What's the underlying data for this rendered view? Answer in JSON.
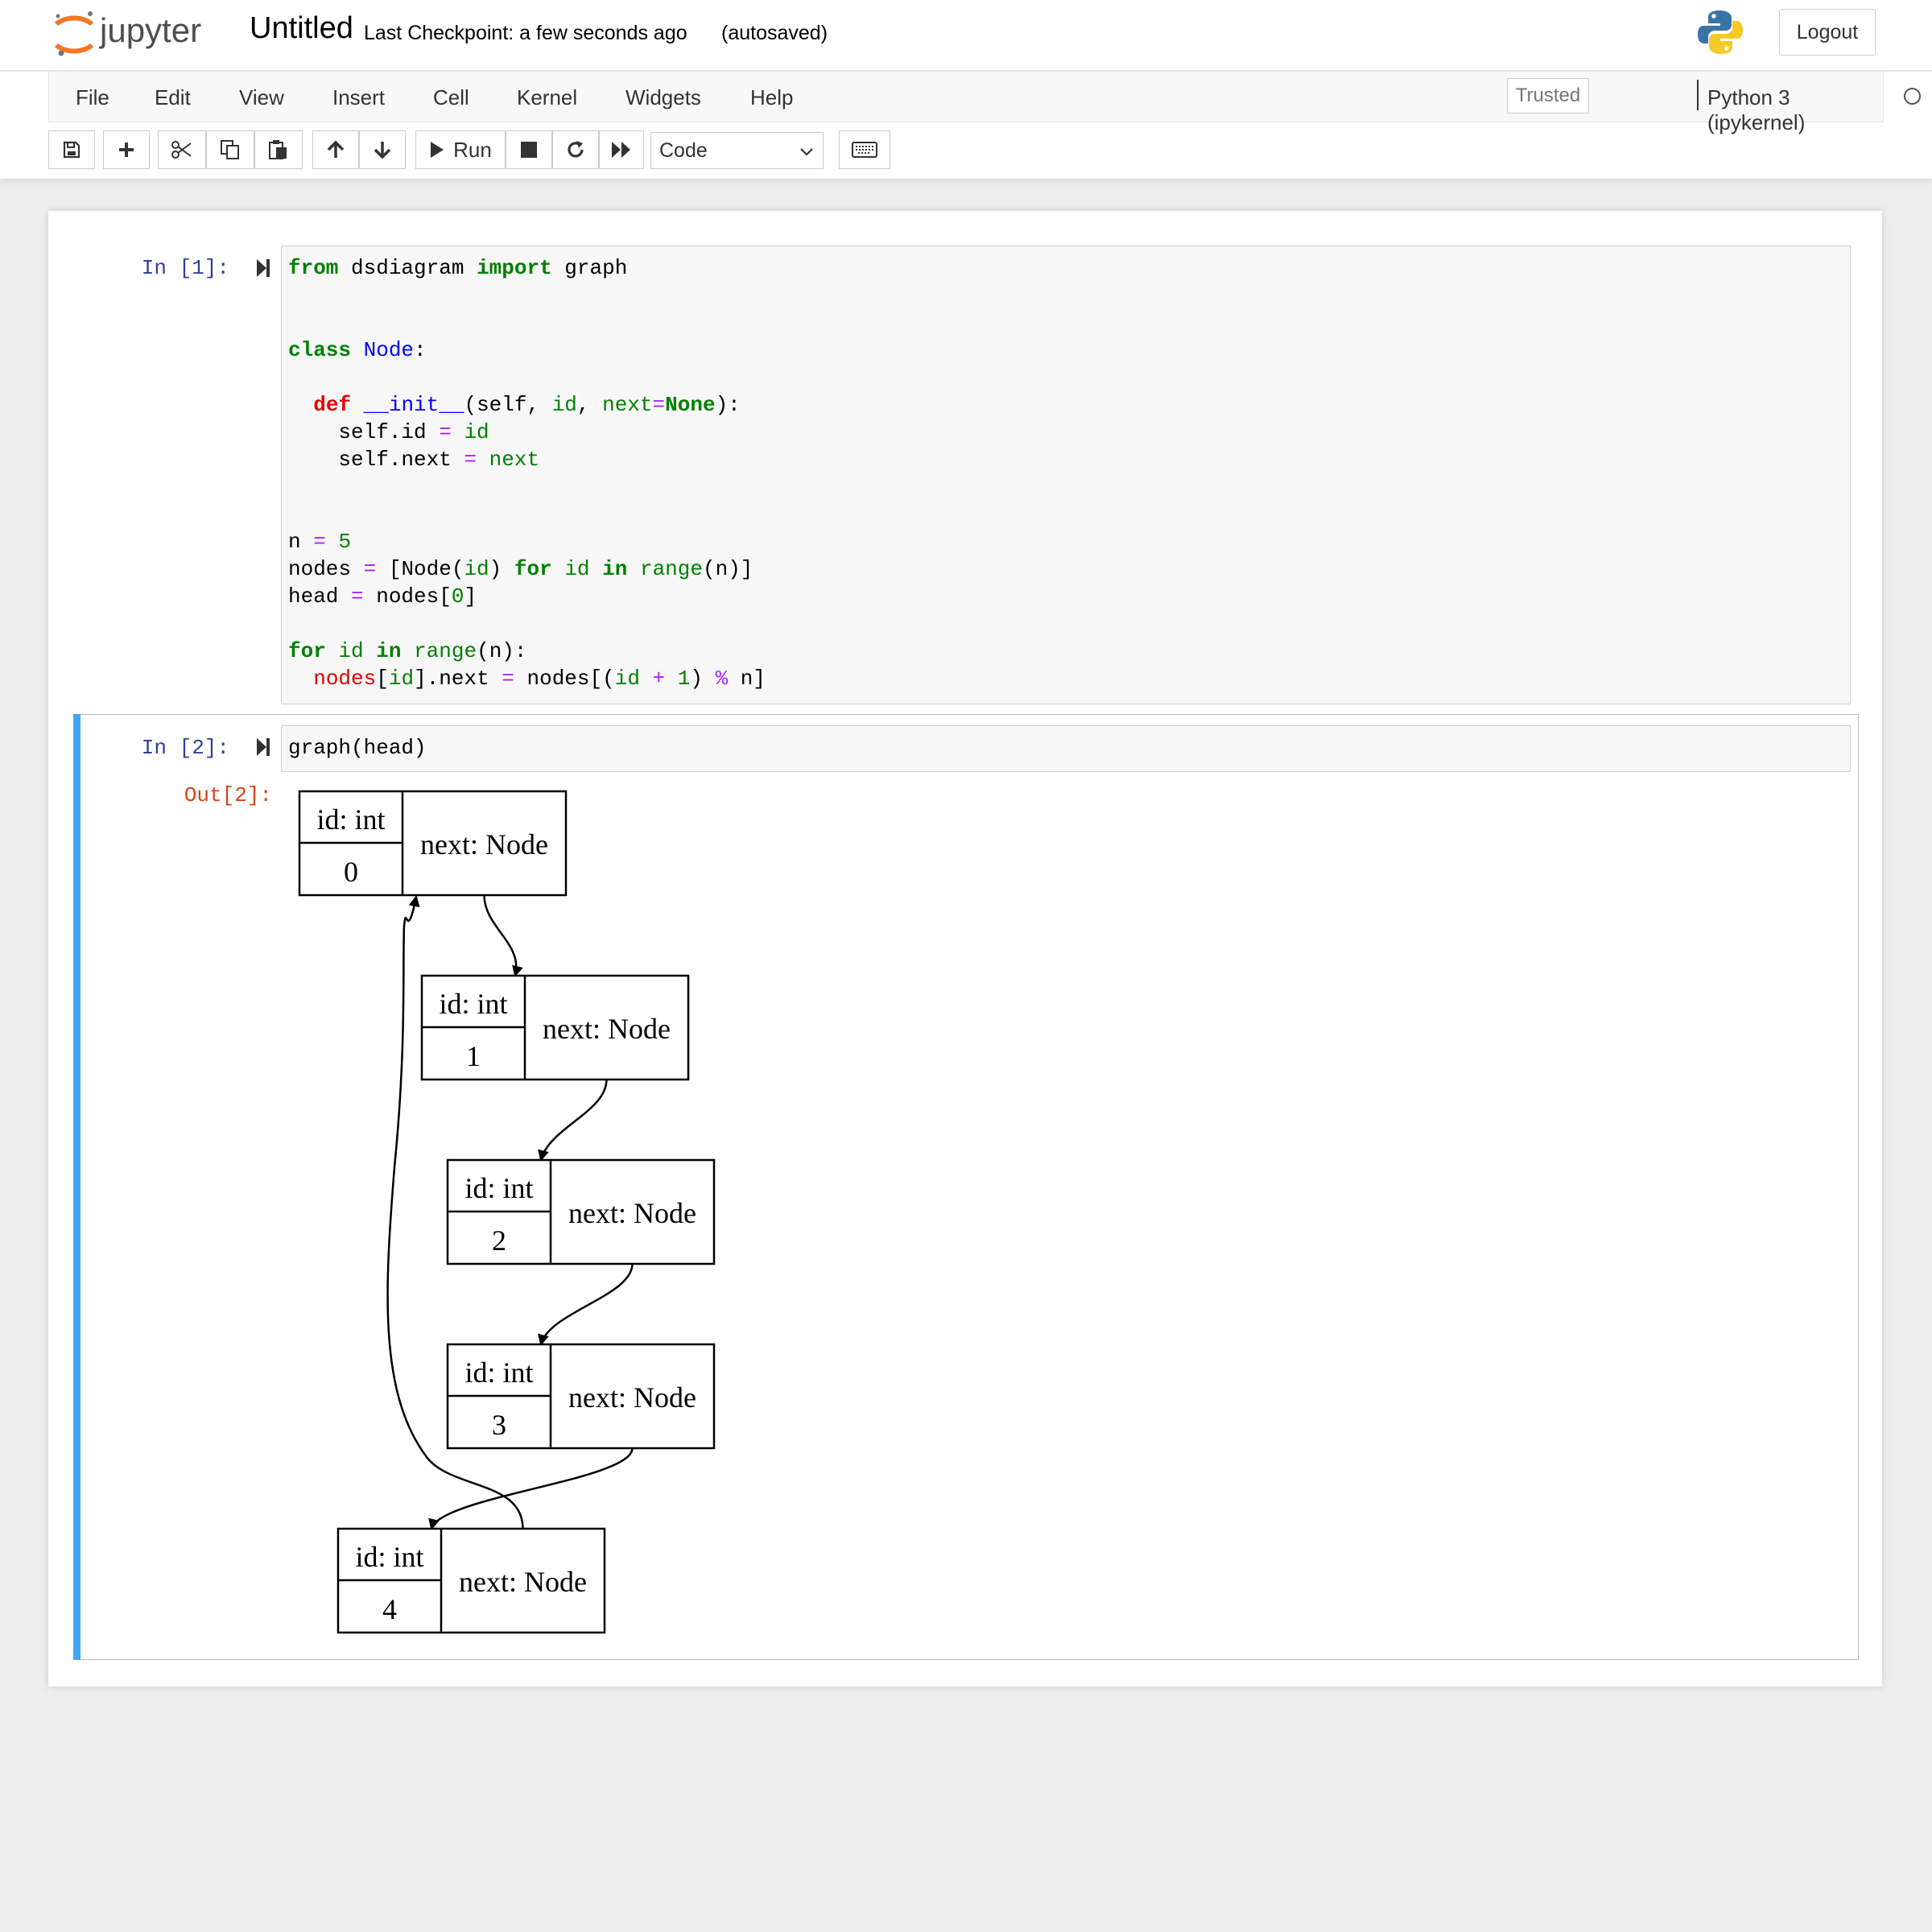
{
  "header": {
    "brand": "jupyter",
    "notebook_title": "Untitled",
    "checkpoint": "Last Checkpoint: a few seconds ago",
    "autosave": "(autosaved)",
    "logout_label": "Logout"
  },
  "menu": {
    "items": [
      "File",
      "Edit",
      "View",
      "Insert",
      "Cell",
      "Kernel",
      "Widgets",
      "Help"
    ],
    "trusted": "Trusted",
    "kernel": "Python 3 (ipykernel)"
  },
  "toolbar": {
    "run_label": "Run",
    "cell_type": "Code",
    "buttons": [
      "save-icon",
      "plus-icon",
      "cut-icon",
      "copy-icon",
      "paste-icon",
      "arrow-up-icon",
      "arrow-down-icon",
      "play-icon",
      "stop-icon",
      "restart-icon",
      "fast-forward-icon",
      "keyboard-icon"
    ]
  },
  "cells": [
    {
      "prompt": "In [1]:",
      "lines": [
        [
          "from",
          " dsdiagram ",
          "import",
          " graph"
        ],
        [],
        [],
        [
          "class",
          " ",
          "Node",
          ":"
        ],
        [],
        [
          "  ",
          "def",
          " ",
          "__init__",
          "(self, ",
          "id",
          ", ",
          "next",
          "=",
          "None",
          "):"
        ],
        [
          "    self.id ",
          "=",
          " ",
          "id"
        ],
        [
          "    self.next ",
          "=",
          " ",
          "next"
        ],
        [],
        [],
        [
          "n ",
          "=",
          " ",
          "5"
        ],
        [
          "nodes ",
          "=",
          " [Node(",
          "id",
          ") ",
          "for",
          " ",
          "id",
          " ",
          "in",
          " ",
          "range",
          "(n)]"
        ],
        [
          "head ",
          "=",
          " nodes[",
          "0",
          "]"
        ],
        [],
        [
          "for",
          " ",
          "id",
          " ",
          "in",
          " ",
          "range",
          "(n):"
        ],
        [
          "  ",
          "nodes",
          "[",
          "id",
          "].next ",
          "=",
          " nodes[(",
          "id",
          " ",
          "+",
          " ",
          "1",
          ") ",
          "%",
          " n]"
        ]
      ]
    },
    {
      "prompt": "In [2]:",
      "code": "graph(head)",
      "out_prompt": "Out[2]:",
      "diagram": {
        "nodes": [
          {
            "id_label": "id: int",
            "id_value": "0",
            "next_label": "next: Node"
          },
          {
            "id_label": "id: int",
            "id_value": "1",
            "next_label": "next: Node"
          },
          {
            "id_label": "id: int",
            "id_value": "2",
            "next_label": "next: Node"
          },
          {
            "id_label": "id: int",
            "id_value": "3",
            "next_label": "next: Node"
          },
          {
            "id_label": "id: int",
            "id_value": "4",
            "next_label": "next: Node"
          }
        ],
        "edges": [
          [
            0,
            1
          ],
          [
            1,
            2
          ],
          [
            2,
            3
          ],
          [
            3,
            4
          ],
          [
            4,
            0
          ]
        ]
      }
    }
  ]
}
